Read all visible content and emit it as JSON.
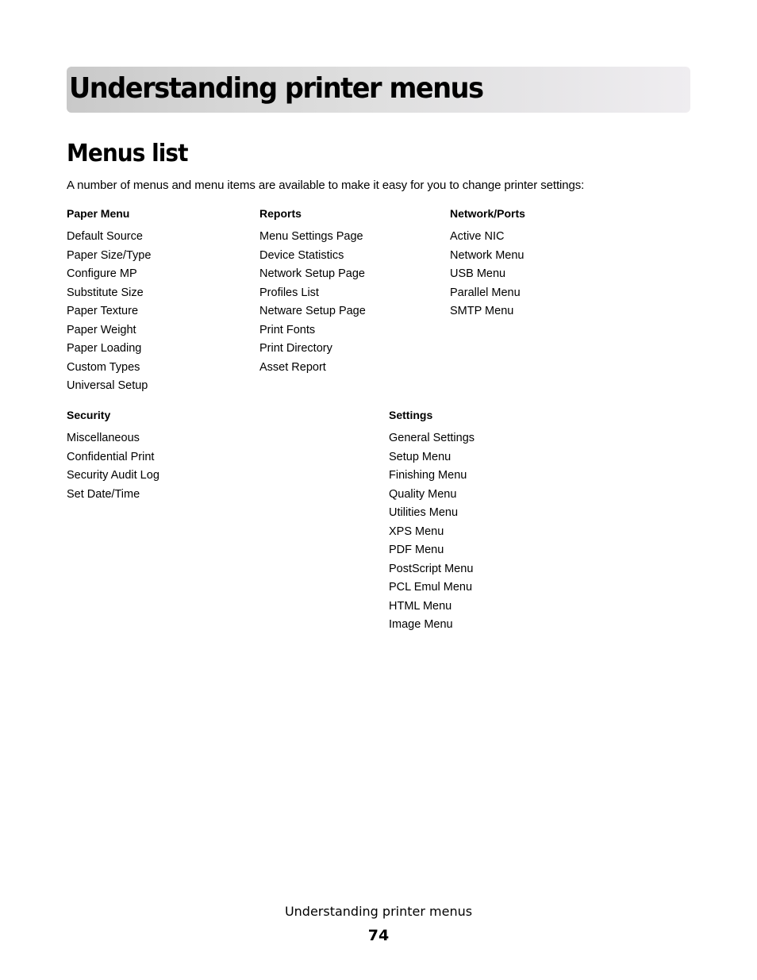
{
  "header": {
    "chapter_title": "Understanding printer menus"
  },
  "section": {
    "title": "Menus list",
    "intro": "A number of menus and menu items are available to make it easy for you to change printer settings:"
  },
  "groups": {
    "paper_menu": {
      "title": "Paper Menu",
      "items": [
        "Default Source",
        "Paper Size/Type",
        "Configure MP",
        "Substitute Size",
        "Paper Texture",
        "Paper Weight",
        "Paper Loading",
        "Custom Types",
        "Universal Setup"
      ]
    },
    "reports": {
      "title": "Reports",
      "items": [
        "Menu Settings Page",
        "Device Statistics",
        "Network Setup Page",
        "Profiles List",
        "Netware Setup Page",
        "Print Fonts",
        "Print Directory",
        "Asset Report"
      ]
    },
    "network_ports": {
      "title": "Network/Ports",
      "items": [
        "Active NIC",
        "Network Menu",
        "USB Menu",
        "Parallel Menu",
        "SMTP Menu"
      ]
    },
    "security": {
      "title": "Security",
      "items": [
        "Miscellaneous",
        "Confidential Print",
        "Security Audit Log",
        "Set Date/Time"
      ]
    },
    "settings": {
      "title": "Settings",
      "items": [
        "General Settings",
        "Setup Menu",
        "Finishing Menu",
        "Quality Menu",
        "Utilities Menu",
        "XPS Menu",
        "PDF Menu",
        "PostScript Menu",
        "PCL Emul Menu",
        "HTML Menu",
        "Image Menu"
      ]
    }
  },
  "footer": {
    "chapter_title": "Understanding printer menus",
    "page_number": "74"
  }
}
